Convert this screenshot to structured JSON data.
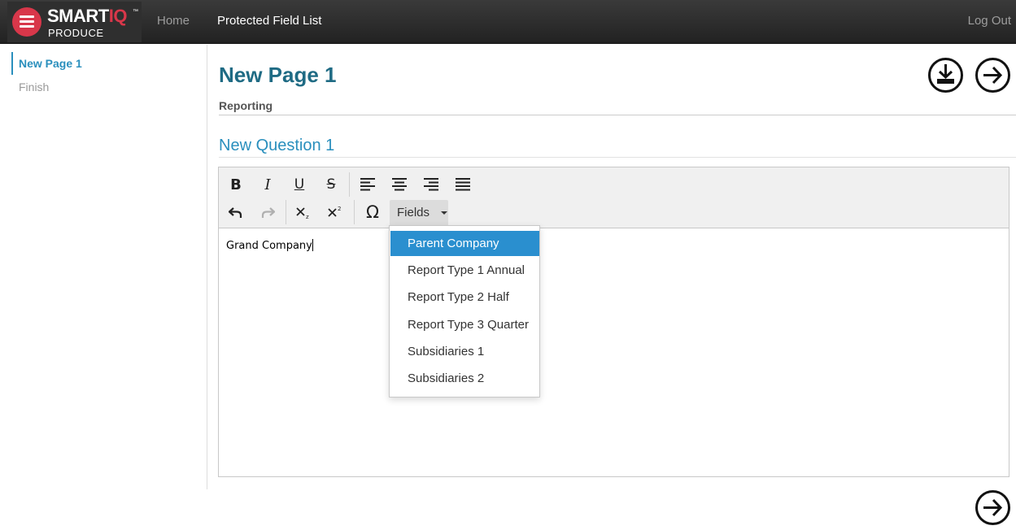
{
  "navbar": {
    "logo": {
      "smart": "SMART",
      "iq": "IQ",
      "tm": "™",
      "produce": "PRODUCE"
    },
    "home": "Home",
    "protected_field_list": "Protected Field List",
    "log_out": "Log Out"
  },
  "sidebar": {
    "items": [
      {
        "label": "New Page 1",
        "active": true
      },
      {
        "label": "Finish",
        "active": false
      }
    ]
  },
  "main": {
    "page_title": "New Page 1",
    "section_label": "Reporting",
    "question_title": "New Question 1"
  },
  "toolbar": {
    "bold": "B",
    "italic": "I",
    "underline": "U",
    "strike": "S",
    "omega": "Ω",
    "fields_label": "Fields"
  },
  "editor": {
    "content": "Grand Company"
  },
  "fields_dropdown": {
    "items": [
      {
        "label": "Parent Company",
        "highlighted": true
      },
      {
        "label": "Report Type 1 Annual"
      },
      {
        "label": "Report Type 2 Half"
      },
      {
        "label": "Report Type 3 Quarter"
      },
      {
        "label": "Subsidiaries 1"
      },
      {
        "label": "Subsidiaries 2"
      }
    ]
  },
  "colors": {
    "accent": "#2a8fbd",
    "title": "#1f6b84",
    "brand_red": "#d8374a",
    "dropdown_highlight": "#2a8fcf"
  }
}
